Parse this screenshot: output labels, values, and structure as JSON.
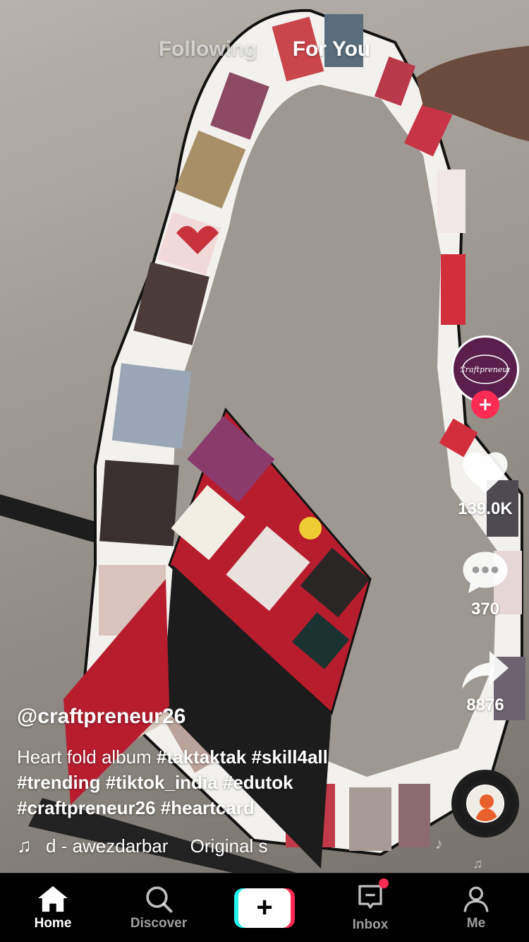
{
  "top_tabs": {
    "following": "Following",
    "for_you": "For You"
  },
  "creator": {
    "avatar_text": "Craftpreneur"
  },
  "actions": {
    "likes": "139.0K",
    "comments": "370",
    "shares": "8876"
  },
  "post": {
    "username": "@craftpreneur26",
    "caption_text": "Heart fold album",
    "hashtags": [
      "#taktaktak",
      "#skill4all",
      "#trending",
      "#tiktok_india",
      "#edutok",
      "#craftpreneur26",
      "#heartcard"
    ],
    "music_author": "d - awezdarbar",
    "music_title": "Original s"
  },
  "nav": {
    "home": "Home",
    "discover": "Discover",
    "create": "+",
    "inbox": "Inbox",
    "me": "Me"
  },
  "colors": {
    "accent_red": "#fe2c55",
    "accent_cyan": "#25f4ee",
    "avatar_bg": "#5a1f4d"
  }
}
